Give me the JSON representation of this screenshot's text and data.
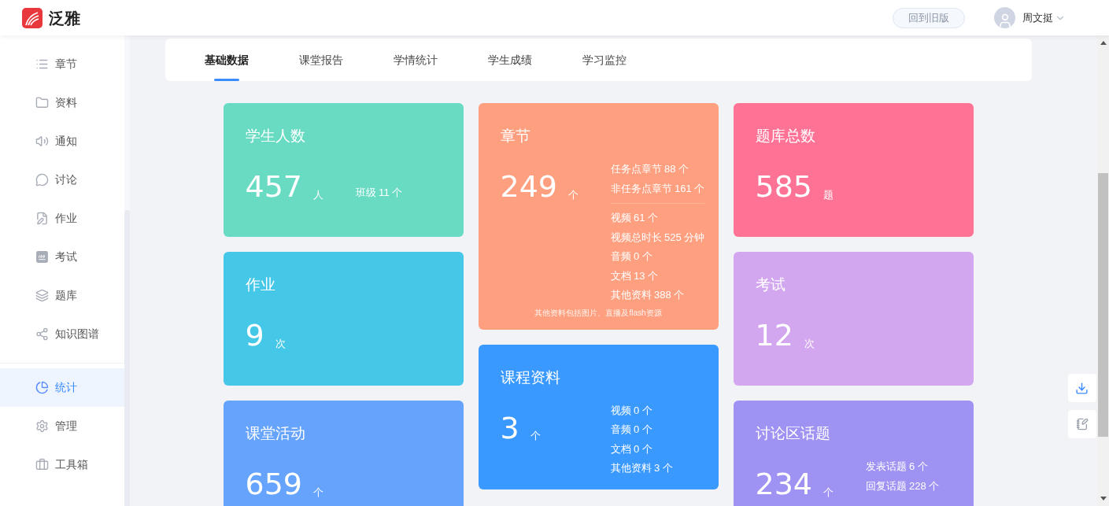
{
  "header": {
    "logo_text": "泛雅",
    "old_version_button": "回到旧版",
    "user_name": "周文挺"
  },
  "sidebar": {
    "items": [
      {
        "label": "章节",
        "selected": false
      },
      {
        "label": "资料",
        "selected": false
      },
      {
        "label": "通知",
        "selected": false
      },
      {
        "label": "讨论",
        "selected": false
      },
      {
        "label": "作业",
        "selected": false
      },
      {
        "label": "考试",
        "selected": false
      },
      {
        "label": "题库",
        "selected": false
      },
      {
        "label": "知识图谱",
        "selected": false
      }
    ],
    "bottom_items": [
      {
        "label": "统计",
        "selected": true
      },
      {
        "label": "管理",
        "selected": false
      },
      {
        "label": "工具箱",
        "selected": false
      }
    ]
  },
  "tabs": [
    {
      "label": "基础数据",
      "selected": true
    },
    {
      "label": "课堂报告",
      "selected": false
    },
    {
      "label": "学情统计",
      "selected": false
    },
    {
      "label": "学生成绩",
      "selected": false
    },
    {
      "label": "学习监控",
      "selected": false
    }
  ],
  "card_columns": [
    [
      {
        "title": "学生人数",
        "value": "457",
        "unit": "人",
        "color": "#68dbc2",
        "details": [
          [
            "班级 11 个"
          ]
        ]
      },
      {
        "title": "作业",
        "value": "9",
        "unit": "次",
        "color": "#45c7e8"
      },
      {
        "title": "课堂活动",
        "value": "659",
        "unit": "个",
        "color": "#65a3fd"
      }
    ],
    [
      {
        "title": "章节",
        "value": "249",
        "unit": "个",
        "color": "#fe9f7f",
        "details": [
          [
            "任务点章节 88 个",
            "非任务点章节 161 个"
          ],
          [
            "视频 61 个",
            "视频总时长 525 分钟",
            "音频 0 个",
            "文档 13 个",
            "其他资料 388 个"
          ]
        ],
        "note": "其他资料包括图片、直播及flash资源"
      },
      {
        "title": "课程资料",
        "value": "3",
        "unit": "个",
        "color": "#3a99ff",
        "details": [
          [
            "视频 0 个",
            "音频 0 个",
            "文档 0 个",
            "其他资料 3 个"
          ]
        ]
      }
    ],
    [
      {
        "title": "题库总数",
        "value": "585",
        "unit": "题",
        "color": "#fe7395"
      },
      {
        "title": "考试",
        "value": "12",
        "unit": "次",
        "color": "#d3a6f0"
      },
      {
        "title": "讨论区话题",
        "value": "234",
        "unit": "个",
        "color": "#9e92f2",
        "details": [
          [
            "发表话题 6 个",
            "回复话题 228 个"
          ]
        ]
      }
    ]
  ]
}
